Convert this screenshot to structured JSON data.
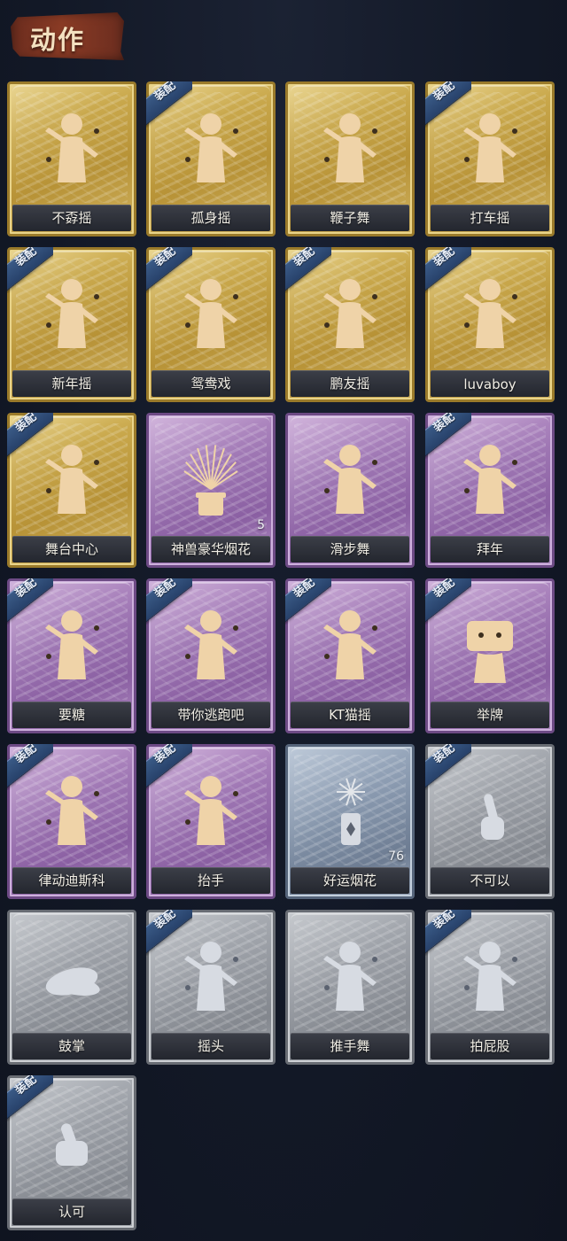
{
  "header": {
    "title": "动作"
  },
  "equip_label": "装配",
  "cards": [
    {
      "label": "不孬摇",
      "rarity": "gold",
      "equipped": false,
      "icon": "dance-figure-icon"
    },
    {
      "label": "孤身摇",
      "rarity": "gold",
      "equipped": true,
      "icon": "dance-figure-icon"
    },
    {
      "label": "鞭子舞",
      "rarity": "gold",
      "equipped": false,
      "icon": "dance-figure-icon"
    },
    {
      "label": "打车摇",
      "rarity": "gold",
      "equipped": true,
      "icon": "dance-figure-icon"
    },
    {
      "label": "新年摇",
      "rarity": "gold",
      "equipped": true,
      "icon": "dance-figure-icon"
    },
    {
      "label": "鸳鸯戏",
      "rarity": "gold",
      "equipped": true,
      "icon": "dance-figure-icon"
    },
    {
      "label": "鹏友摇",
      "rarity": "gold",
      "equipped": true,
      "icon": "dance-figure-icon"
    },
    {
      "label": "luvaboy",
      "rarity": "gold",
      "equipped": true,
      "icon": "dance-figure-icon"
    },
    {
      "label": "舞台中心",
      "rarity": "gold",
      "equipped": true,
      "icon": "dance-figure-icon"
    },
    {
      "label": "神兽豪华烟花",
      "rarity": "purple",
      "equipped": false,
      "icon": "fireworks-pot-icon",
      "count": "5"
    },
    {
      "label": "滑步舞",
      "rarity": "purple",
      "equipped": false,
      "icon": "dance-figure-icon"
    },
    {
      "label": "拜年",
      "rarity": "purple",
      "equipped": true,
      "icon": "bow-figure-icon"
    },
    {
      "label": "要糖",
      "rarity": "purple",
      "equipped": true,
      "icon": "reach-figure-icon"
    },
    {
      "label": "带你逃跑吧",
      "rarity": "purple",
      "equipped": true,
      "icon": "dance-figure-icon"
    },
    {
      "label": "KT猫摇",
      "rarity": "purple",
      "equipped": true,
      "icon": "dance-figure-icon"
    },
    {
      "label": "举牌",
      "rarity": "purple",
      "equipped": true,
      "icon": "sign-figure-icon"
    },
    {
      "label": "律动迪斯科",
      "rarity": "purple",
      "equipped": true,
      "icon": "dance-figure-icon"
    },
    {
      "label": "抬手",
      "rarity": "purple",
      "equipped": true,
      "icon": "raise-hand-figure-icon"
    },
    {
      "label": "好运烟花",
      "rarity": "blue",
      "equipped": false,
      "icon": "firecracker-icon",
      "count": "76"
    },
    {
      "label": "不可以",
      "rarity": "gray",
      "equipped": true,
      "icon": "finger-wag-icon"
    },
    {
      "label": "鼓掌",
      "rarity": "gray",
      "equipped": false,
      "icon": "clap-hands-icon"
    },
    {
      "label": "摇头",
      "rarity": "gray",
      "equipped": true,
      "icon": "shake-head-figure-icon"
    },
    {
      "label": "推手舞",
      "rarity": "gray",
      "equipped": false,
      "icon": "push-hands-figure-icon"
    },
    {
      "label": "拍屁股",
      "rarity": "gray",
      "equipped": true,
      "icon": "pat-figure-icon"
    },
    {
      "label": "认可",
      "rarity": "gray",
      "equipped": true,
      "icon": "thumbs-up-icon"
    }
  ]
}
